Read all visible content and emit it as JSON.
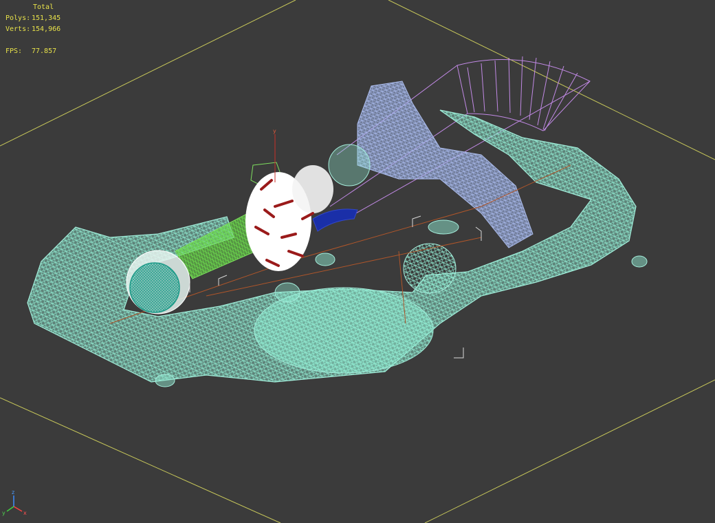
{
  "viewport": {
    "stats": {
      "title": "Total",
      "polys_label": "Polys:",
      "polys_value": "151,345",
      "verts_label": "Verts:",
      "verts_value": "154,966",
      "fps_label": "FPS:",
      "fps_value": "77.857"
    },
    "scene_gizmo_axis": "y",
    "axis_tripod": {
      "x": "x",
      "y": "y",
      "z": "z"
    }
  },
  "colors": {
    "background": "#3b3b3b",
    "grid": "#c8c85a",
    "terrain": "#8fe8cf",
    "canopy": "#9db3e8",
    "frustum": "#c28ae6",
    "tube": "#6cdb4c",
    "stats_text": "#e8e24a"
  }
}
